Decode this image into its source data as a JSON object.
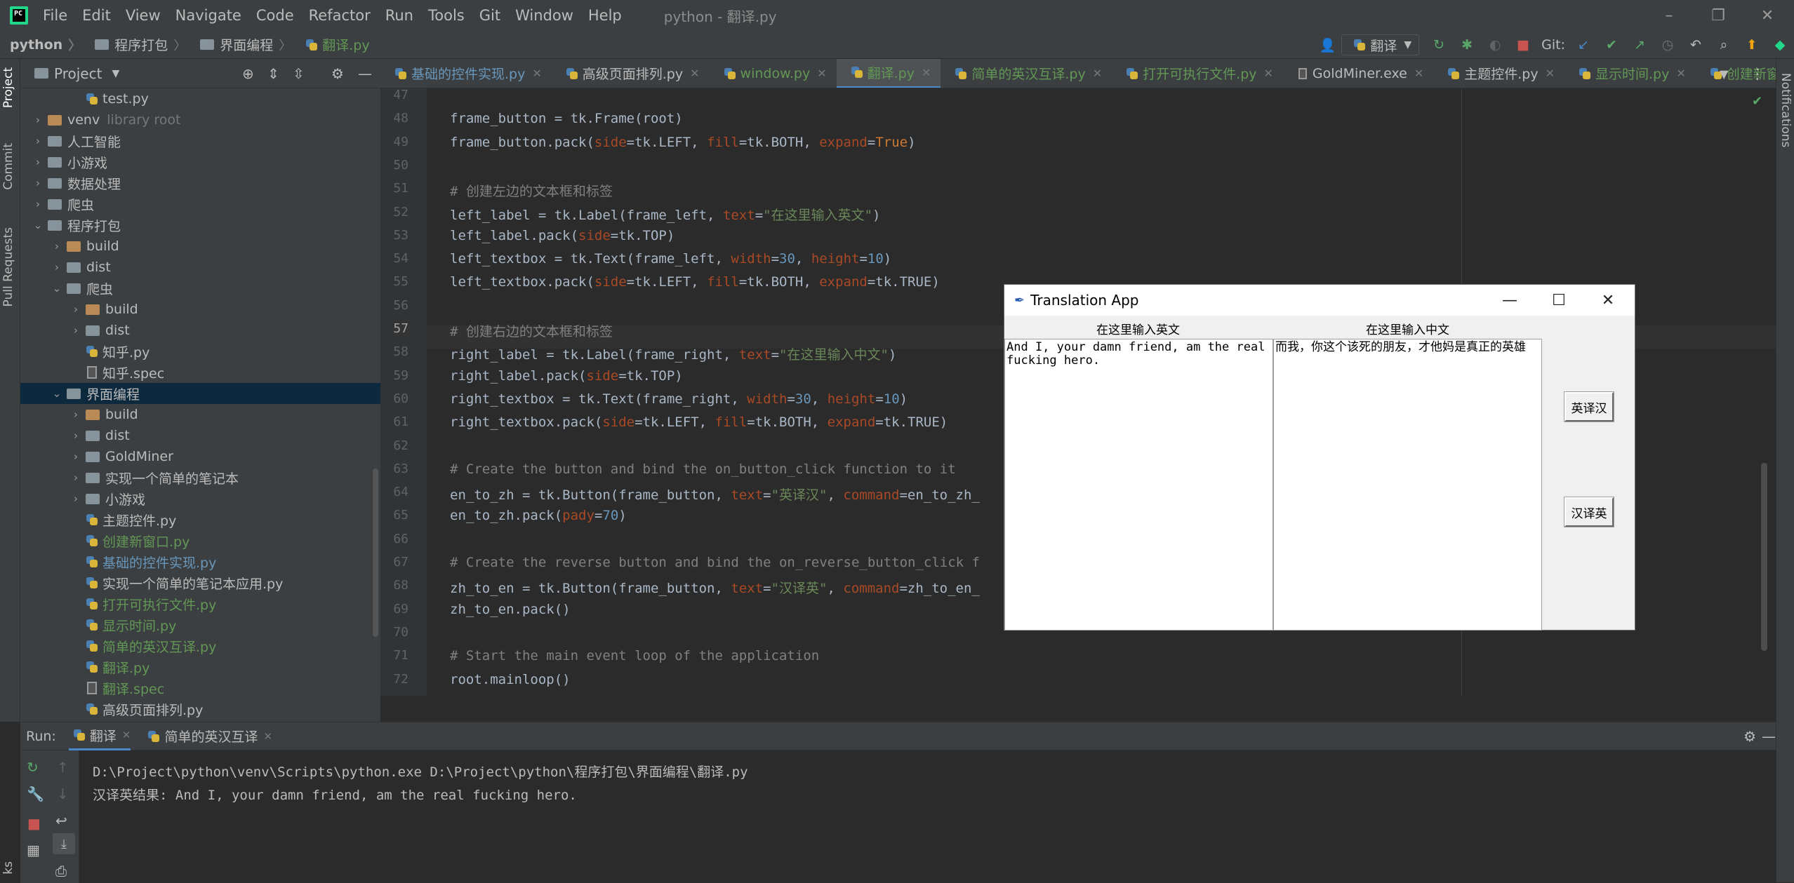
{
  "menubar": {
    "logo": "PC",
    "items": [
      "File",
      "Edit",
      "View",
      "Navigate",
      "Code",
      "Refactor",
      "Run",
      "Tools",
      "Git",
      "Window",
      "Help"
    ],
    "window_title": "python - 翻译.py",
    "controls": [
      "–",
      "❐",
      "✕"
    ]
  },
  "navbar": {
    "breadcrumbs": [
      "python",
      "程序打包",
      "界面编程",
      "翻译.py"
    ],
    "run_config": "翻译",
    "git_label": "Git:"
  },
  "left_strip": {
    "tabs": [
      "Project",
      "Commit",
      "Pull Requests"
    ],
    "bottom": "ks"
  },
  "right_strip": {
    "tabs": [
      "Notifications"
    ]
  },
  "project": {
    "title": "Project",
    "tree": [
      {
        "label": "test.py",
        "type": "py",
        "depth": 3,
        "expandable": false
      },
      {
        "label": "venv",
        "type": "folder-orange",
        "depth": 1,
        "expandable": true,
        "note": "library root"
      },
      {
        "label": "人工智能",
        "type": "folder",
        "depth": 1,
        "expandable": true
      },
      {
        "label": "小游戏",
        "type": "folder",
        "depth": 1,
        "expandable": true
      },
      {
        "label": "数据处理",
        "type": "folder",
        "depth": 1,
        "expandable": true
      },
      {
        "label": "爬虫",
        "type": "folder",
        "depth": 1,
        "expandable": true
      },
      {
        "label": "程序打包",
        "type": "folder",
        "depth": 1,
        "expandable": true,
        "open": true
      },
      {
        "label": "build",
        "type": "folder-orange",
        "depth": 2,
        "expandable": true
      },
      {
        "label": "dist",
        "type": "folder",
        "depth": 2,
        "expandable": true
      },
      {
        "label": "爬虫",
        "type": "folder",
        "depth": 2,
        "expandable": true,
        "open": true
      },
      {
        "label": "build",
        "type": "folder-orange",
        "depth": 3,
        "expandable": true
      },
      {
        "label": "dist",
        "type": "folder",
        "depth": 3,
        "expandable": true
      },
      {
        "label": "知乎.py",
        "type": "py",
        "depth": 3,
        "expandable": false
      },
      {
        "label": "知乎.spec",
        "type": "spec",
        "depth": 3,
        "expandable": false
      },
      {
        "label": "界面编程",
        "type": "folder",
        "depth": 2,
        "expandable": true,
        "open": true,
        "selected": true
      },
      {
        "label": "build",
        "type": "folder-orange",
        "depth": 3,
        "expandable": true
      },
      {
        "label": "dist",
        "type": "folder",
        "depth": 3,
        "expandable": true
      },
      {
        "label": "GoldMiner",
        "type": "folder",
        "depth": 3,
        "expandable": true
      },
      {
        "label": "实现一个简单的笔记本",
        "type": "folder",
        "depth": 3,
        "expandable": true
      },
      {
        "label": "小游戏",
        "type": "folder",
        "depth": 3,
        "expandable": true
      },
      {
        "label": "主题控件.py",
        "type": "py",
        "depth": 3,
        "expandable": false
      },
      {
        "label": "创建新窗口.py",
        "type": "py",
        "depth": 3,
        "expandable": false,
        "green": true
      },
      {
        "label": "基础的控件实现.py",
        "type": "py",
        "depth": 3,
        "expandable": false,
        "blue": true
      },
      {
        "label": "实现一个简单的笔记本应用.py",
        "type": "py",
        "depth": 3,
        "expandable": false
      },
      {
        "label": "打开可执行文件.py",
        "type": "py",
        "depth": 3,
        "expandable": false,
        "green": true
      },
      {
        "label": "显示时间.py",
        "type": "py",
        "depth": 3,
        "expandable": false,
        "green": true
      },
      {
        "label": "简单的英汉互译.py",
        "type": "py",
        "depth": 3,
        "expandable": false,
        "green": true
      },
      {
        "label": "翻译.py",
        "type": "py",
        "depth": 3,
        "expandable": false,
        "green": true
      },
      {
        "label": "翻译.spec",
        "type": "spec",
        "depth": 3,
        "expandable": false,
        "green": true
      },
      {
        "label": "高级页面排列.py",
        "type": "py",
        "depth": 3,
        "expandable": false
      }
    ]
  },
  "editor_tabs": [
    {
      "label": "基础的控件实现.py",
      "color": "#6897bb",
      "icon": "py"
    },
    {
      "label": "高级页面排列.py",
      "color": "#bbbbbb",
      "icon": "py"
    },
    {
      "label": "window.py",
      "color": "#629755",
      "icon": "py"
    },
    {
      "label": "翻译.py",
      "color": "#629755",
      "icon": "py",
      "active": true
    },
    {
      "label": "简单的英汉互译.py",
      "color": "#629755",
      "icon": "py"
    },
    {
      "label": "打开可执行文件.py",
      "color": "#629755",
      "icon": "py"
    },
    {
      "label": "GoldMiner.exe",
      "color": "#bbbbbb",
      "icon": "file"
    },
    {
      "label": "主题控件.py",
      "color": "#bbbbbb",
      "icon": "py"
    },
    {
      "label": "显示时间.py",
      "color": "#629755",
      "icon": "py"
    },
    {
      "label": "创建新窗口.p",
      "color": "#629755",
      "icon": "py"
    }
  ],
  "code": {
    "current_line": 57,
    "lines": [
      {
        "n": "47",
        "html": ""
      },
      {
        "n": "48",
        "html": "frame_button = tk.Frame(root)"
      },
      {
        "n": "49",
        "html": "frame_button.pack(<span class=\"pa\">side</span>=tk.LEFT, <span class=\"pa\">fill</span>=tk.BOTH, <span class=\"pa\">expand</span>=<span class=\"kw\">True</span>)"
      },
      {
        "n": "50",
        "html": ""
      },
      {
        "n": "51",
        "html": "<span class=\"cm\"># 创建左边的文本框和标签</span>"
      },
      {
        "n": "52",
        "html": "left_label = tk.Label(frame_left, <span class=\"pa\">text</span>=<span class=\"st\">\"在这里输入英文\"</span>)"
      },
      {
        "n": "53",
        "html": "left_label.pack(<span class=\"pa\">side</span>=tk.TOP)"
      },
      {
        "n": "54",
        "html": "left_textbox = tk.Text(frame_left, <span class=\"pa\">width</span>=<span class=\"nm\">30</span>, <span class=\"pa\">height</span>=<span class=\"nm\">10</span>)"
      },
      {
        "n": "55",
        "html": "left_textbox.pack(<span class=\"pa\">side</span>=tk.LEFT, <span class=\"pa\">fill</span>=tk.BOTH, <span class=\"pa\">expand</span>=tk.TRUE)"
      },
      {
        "n": "56",
        "html": ""
      },
      {
        "n": "57",
        "html": "<span class=\"cm\"># 创建右边的文本框和标签</span>"
      },
      {
        "n": "58",
        "html": "right_label = tk.Label(frame_right, <span class=\"pa\">text</span>=<span class=\"st\">\"在这里输入中文\"</span>)"
      },
      {
        "n": "59",
        "html": "right_label.pack(<span class=\"pa\">side</span>=tk.TOP)"
      },
      {
        "n": "60",
        "html": "right_textbox = tk.Text(frame_right, <span class=\"pa\">width</span>=<span class=\"nm\">30</span>, <span class=\"pa\">height</span>=<span class=\"nm\">10</span>)"
      },
      {
        "n": "61",
        "html": "right_textbox.pack(<span class=\"pa\">side</span>=tk.LEFT, <span class=\"pa\">fill</span>=tk.BOTH, <span class=\"pa\">expand</span>=tk.TRUE)"
      },
      {
        "n": "62",
        "html": ""
      },
      {
        "n": "63",
        "html": "<span class=\"cm\"># Create the button and bind the on_button_click function to it</span>"
      },
      {
        "n": "64",
        "html": "en_to_zh = tk.Button(frame_button, <span class=\"pa\">text</span>=<span class=\"st\">\"英译汉\"</span>, <span class=\"pa\">command</span>=en_to_zh_"
      },
      {
        "n": "65",
        "html": "en_to_zh.pack(<span class=\"pa\">pady</span>=<span class=\"nm\">70</span>)"
      },
      {
        "n": "66",
        "html": ""
      },
      {
        "n": "67",
        "html": "<span class=\"cm\"># Create the reverse button and bind the on_reverse_button_click f</span>"
      },
      {
        "n": "68",
        "html": "zh_to_en = tk.Button(frame_button, <span class=\"pa\">text</span>=<span class=\"st\">\"汉译英\"</span>, <span class=\"pa\">command</span>=zh_to_en_"
      },
      {
        "n": "69",
        "html": "zh_to_en.pack()"
      },
      {
        "n": "70",
        "html": ""
      },
      {
        "n": "71",
        "html": "<span class=\"cm\"># Start the main event loop of the application</span>"
      },
      {
        "n": "72",
        "html": "root.mainloop()"
      }
    ]
  },
  "run": {
    "label": "Run:",
    "tabs": [
      {
        "label": "翻译",
        "active": true
      },
      {
        "label": "简单的英汉互译",
        "active": false
      }
    ],
    "console": [
      "D:\\Project\\python\\venv\\Scripts\\python.exe D:\\Project\\python\\程序打包\\界面编程\\翻译.py",
      "汉译英结果: And I, your damn friend, am the real fucking hero."
    ]
  },
  "tk_app": {
    "title": "Translation App",
    "left_label": "在这里输入英文",
    "right_label": "在这里输入中文",
    "left_text": "And I, your damn friend, am the real fucking hero.",
    "right_text": "而我，你这个该死的朋友，才他妈是真正的英雄",
    "btn_en_zh": "英译汉",
    "btn_zh_en": "汉译英",
    "controls": [
      "—",
      "☐",
      "✕"
    ]
  }
}
